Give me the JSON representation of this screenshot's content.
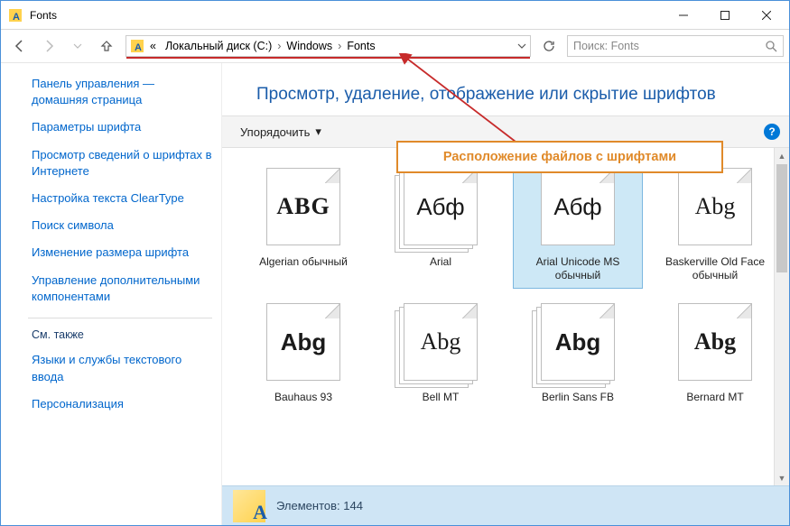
{
  "window": {
    "title": "Fonts"
  },
  "breadcrumb": {
    "prefix": "«",
    "items": [
      "Локальный диск (C:)",
      "Windows",
      "Fonts"
    ]
  },
  "search": {
    "placeholder": "Поиск: Fonts"
  },
  "sidebar": {
    "links": [
      "Панель управления — домашняя страница",
      "Параметры шрифта",
      "Просмотр сведений о шрифтах в Интернете",
      "Настройка текста ClearType",
      "Поиск символа",
      "Изменение размера шрифта",
      "Управление дополнительными компонентами"
    ],
    "see_also_label": "См. также",
    "see_also": [
      "Языки и службы текстового ввода",
      "Персонализация"
    ]
  },
  "main": {
    "title": "Просмотр, удаление, отображение или скрытие шрифтов",
    "organize_label": "Упорядочить"
  },
  "annotation": {
    "text": "Расположение файлов с шрифтами"
  },
  "fonts": [
    {
      "sample": "ABG",
      "label": "Algerian обычный",
      "cls": "f-algerian",
      "stack": false
    },
    {
      "sample": "Абф",
      "label": "Arial",
      "cls": "f-arial",
      "stack": true
    },
    {
      "sample": "Абф",
      "label": "Arial Unicode MS обычный",
      "cls": "f-arial",
      "stack": false,
      "selected": true
    },
    {
      "sample": "Abg",
      "label": "Baskerville Old Face обычный",
      "cls": "f-bask",
      "stack": false
    },
    {
      "sample": "Abg",
      "label": "Bauhaus 93",
      "cls": "f-bauhaus",
      "stack": false
    },
    {
      "sample": "Abg",
      "label": "Bell MT",
      "cls": "f-bell",
      "stack": true
    },
    {
      "sample": "Abg",
      "label": "Berlin Sans FB",
      "cls": "f-berlin",
      "stack": true
    },
    {
      "sample": "Abg",
      "label": "Bernard MT",
      "cls": "f-bernard",
      "stack": false
    }
  ],
  "statusbar": {
    "count_label": "Элементов: 144"
  }
}
